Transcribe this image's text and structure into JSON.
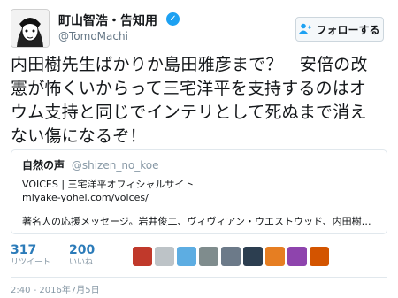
{
  "user": {
    "name": "町山智浩・告知用",
    "handle": "@TomoMachi",
    "verified_icon": "verified-badge-icon"
  },
  "follow_button": {
    "label": "フォローする",
    "icon": "follow-person-icon"
  },
  "tweet": {
    "lines": [
      "内田樹先生ばかりか島田雅彦まで？　安倍の改",
      "憲が怖くいからって三宅洋平を支持するのはオ",
      "ウム支持と同じでインテリとして死ぬまで消え",
      "ない傷になるぞ！"
    ]
  },
  "quoted": {
    "author_name": "自然の声",
    "author_handle": "@shizen_no_koe",
    "line1": "VOICES | 三宅洋平オフィシャルサイト",
    "line2": "miyake-yohei.com/voices/",
    "line3": "著名人の応援メッセージ。岩井俊二、ヴィヴィアン・ウエストウッド、内田樹、…"
  },
  "stats": {
    "retweets": {
      "count": "317",
      "label": "リツイート"
    },
    "likes": {
      "count": "200",
      "label": "いいね"
    }
  },
  "liker_avatars": [
    {
      "color": "#c0392b"
    },
    {
      "color": "#bdc3c7"
    },
    {
      "color": "#5dade2"
    },
    {
      "color": "#7f8c8d"
    },
    {
      "color": "#6c7a89"
    },
    {
      "color": "#2c3e50"
    },
    {
      "color": "#e67e22"
    },
    {
      "color": "#8e44ad"
    },
    {
      "color": "#d35400"
    }
  ],
  "timestamp": "2:40 - 2016年7月5日",
  "colors": {
    "accent": "#1da1f2",
    "link": "#2b7bb9",
    "muted": "#8899a6"
  }
}
